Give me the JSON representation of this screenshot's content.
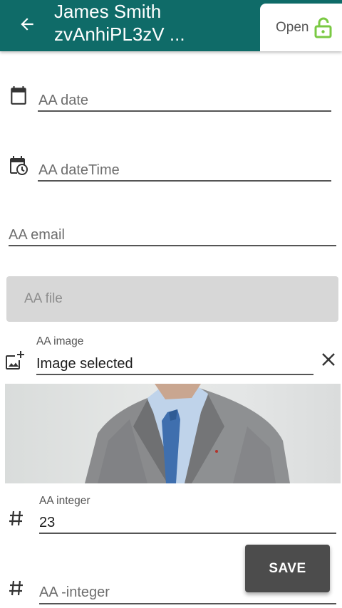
{
  "header": {
    "title_line1": "James Smith",
    "title_line2": "zvAnhiPL3zV ...",
    "status_label": "Open",
    "back_icon": "arrow-back-icon",
    "status_icon": "lock-open-icon",
    "bar_color": "#0f6b68",
    "status_icon_color": "#7ac943"
  },
  "form": {
    "date": {
      "placeholder": "AA date",
      "icon": "calendar-icon"
    },
    "datetime": {
      "placeholder": "AA dateTime",
      "icon": "calendar-clock-icon"
    },
    "email": {
      "placeholder": "AA email"
    },
    "file": {
      "placeholder": "AA file"
    },
    "image": {
      "label": "AA image",
      "value": "Image selected",
      "icon": "add-photo-icon",
      "clear_icon": "close-icon"
    },
    "integer": {
      "label": "AA integer",
      "value": "23",
      "icon": "hash-icon"
    },
    "neg_integer": {
      "placeholder": "AA -integer",
      "icon": "hash-icon"
    }
  },
  "actions": {
    "save_label": "SAVE"
  }
}
